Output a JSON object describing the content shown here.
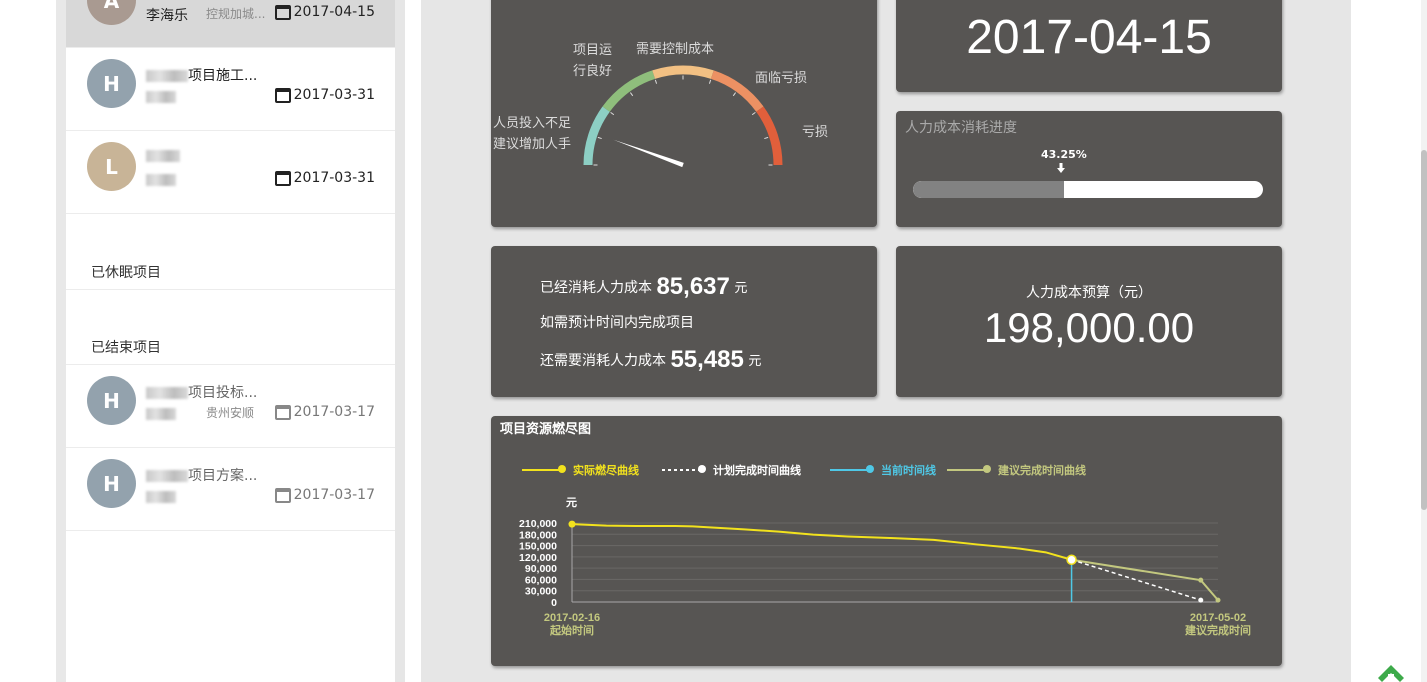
{
  "sidebar": {
    "projects": [
      {
        "avatar": "A",
        "name": "李海乐",
        "tag": "控规加城...",
        "date": "2017-04-15",
        "active": true
      },
      {
        "avatar": "H",
        "name": "项目施工...",
        "date": "2017-03-31"
      },
      {
        "avatar": "L",
        "date": "2017-03-31"
      }
    ],
    "dormant_label": "已休眠项目",
    "ended_label": "已结束项目",
    "ended_projects": [
      {
        "avatar": "H",
        "name": "项目投标...",
        "tag": "贵州安顺",
        "date": "2017-03-17"
      },
      {
        "avatar": "H",
        "name": "项目方案...",
        "date": "2017-03-17"
      }
    ]
  },
  "gauge": {
    "labels": [
      "人员投入不足",
      "建议增加人手",
      "项目运",
      "行良好",
      "需要控制成本",
      "面临亏损",
      "亏损"
    ],
    "colors": [
      "#8dcfc4",
      "#8fbe7c",
      "#f2c083",
      "#ec9163",
      "#e15f3b"
    ]
  },
  "date_card": {
    "value": "2017-04-15"
  },
  "progress": {
    "title": "人力成本消耗进度",
    "percent_label": "43.25%",
    "fraction": 0.4325
  },
  "cost": {
    "line1_prefix": "已经消耗人力成本",
    "consumed": "85,637",
    "unit": "元",
    "line2": "如需预计时间内完成项目",
    "line3_prefix": "还需要消耗人力成本",
    "remaining": "55,485"
  },
  "budget": {
    "title": "人力成本预算（元）",
    "value": "198,000.00"
  },
  "burndown": {
    "title": "项目资源燃尽图",
    "legend": [
      {
        "label": "实际燃尽曲线",
        "color": "#f2e21d"
      },
      {
        "label": "计划完成时间曲线",
        "color": "#ffffff"
      },
      {
        "label": "当前时间线",
        "color": "#4fc8e6"
      },
      {
        "label": "建议完成时间曲线",
        "color": "#c3c87f"
      }
    ],
    "y_unit": "元",
    "y_ticks": [
      "210,000",
      "180,000",
      "150,000",
      "120,000",
      "90,000",
      "60,000",
      "30,000",
      "0"
    ],
    "x_start": {
      "date": "2017-02-16",
      "label": "起始时间"
    },
    "x_end": {
      "date": "2017-05-02",
      "label": "建议完成时间"
    }
  },
  "chart_data": {
    "type": "line",
    "title": "项目资源燃尽图",
    "ylabel": "元",
    "ylim": [
      0,
      210000
    ],
    "xlim": [
      "2017-02-16",
      "2017-05-02"
    ],
    "series": [
      {
        "name": "实际燃尽曲线",
        "x": [
          "2017-02-16",
          "2017-02-20",
          "2017-02-24",
          "2017-02-28",
          "2017-03-02",
          "2017-03-05",
          "2017-03-08",
          "2017-03-12",
          "2017-03-16",
          "2017-03-20",
          "2017-03-25",
          "2017-03-30",
          "2017-04-04",
          "2017-04-09",
          "2017-04-12",
          "2017-04-15"
        ],
        "values": [
          207000,
          203000,
          202000,
          202000,
          201000,
          197000,
          193000,
          187000,
          179000,
          174000,
          170000,
          165000,
          153000,
          142000,
          132000,
          112363
        ]
      },
      {
        "name": "计划完成时间曲线",
        "x": [
          "2017-04-15",
          "2017-04-30"
        ],
        "values": [
          112363,
          5000
        ]
      },
      {
        "name": "当前时间线",
        "x": [
          "2017-04-15",
          "2017-04-15"
        ],
        "values": [
          0,
          112363
        ]
      },
      {
        "name": "建议完成时间曲线",
        "x": [
          "2017-04-15",
          "2017-04-30",
          "2017-05-02"
        ],
        "values": [
          112363,
          58000,
          5000
        ]
      }
    ]
  }
}
